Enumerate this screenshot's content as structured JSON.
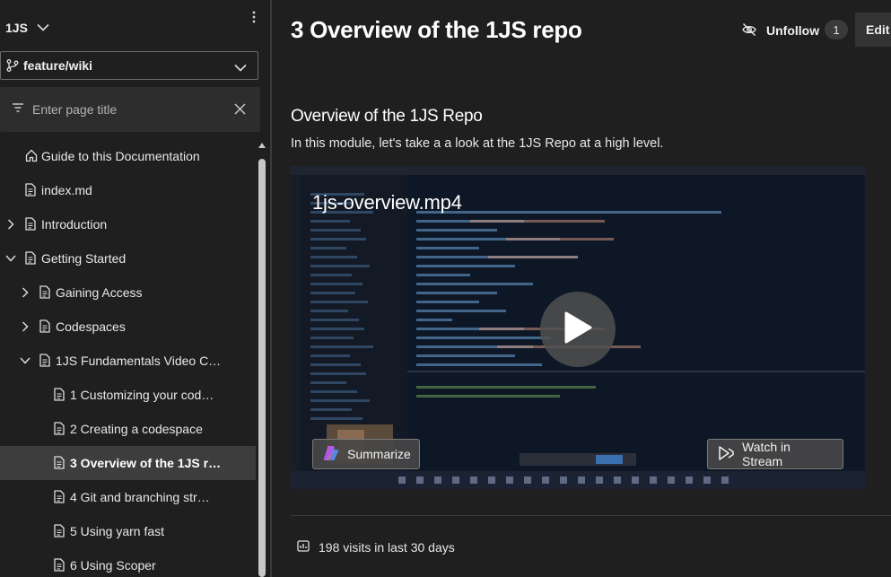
{
  "sidebar": {
    "wiki_name": "1JS",
    "branch": "feature/wiki",
    "filter_placeholder": "Enter page title",
    "tree": [
      {
        "label": "Guide to this Documentation",
        "level": 0,
        "expander": "none",
        "selected": false
      },
      {
        "label": "index.md",
        "level": 0,
        "expander": "none",
        "selected": false
      },
      {
        "label": "Introduction",
        "level": 0,
        "expander": "collapsed",
        "selected": false
      },
      {
        "label": "Getting Started",
        "level": 0,
        "expander": "expanded",
        "selected": false
      },
      {
        "label": "Gaining Access",
        "level": 1,
        "expander": "collapsed",
        "selected": false
      },
      {
        "label": "Codespaces",
        "level": 1,
        "expander": "collapsed",
        "selected": false
      },
      {
        "label": "1JS Fundamentals Video C…",
        "level": 1,
        "expander": "expanded",
        "selected": false
      },
      {
        "label": "1 Customizing your cod…",
        "level": 2,
        "expander": "none",
        "selected": false
      },
      {
        "label": "2 Creating a codespace",
        "level": 2,
        "expander": "none",
        "selected": false
      },
      {
        "label": "3 Overview of the 1JS r…",
        "level": 2,
        "expander": "none",
        "selected": true
      },
      {
        "label": "4 Git and branching str…",
        "level": 2,
        "expander": "none",
        "selected": false
      },
      {
        "label": "5 Using yarn fast",
        "level": 2,
        "expander": "none",
        "selected": false
      },
      {
        "label": "6 Using Scoper",
        "level": 2,
        "expander": "none",
        "selected": false
      }
    ]
  },
  "header": {
    "title": "3 Overview of the 1JS repo",
    "unfollow_label": "Unfollow",
    "follow_count": "1",
    "edit_label": "Edit"
  },
  "content": {
    "heading": "Overview of the 1JS Repo",
    "intro": "In this module, let's take a a look at the 1JS Repo at a high level.",
    "video": {
      "filename": "1js-overview.mp4",
      "summarize_label": "Summarize",
      "watch_label": "Watch in Stream"
    }
  },
  "footer": {
    "visits": "198 visits in last 30 days"
  },
  "icons": {
    "home": "home-icon",
    "page": "page-icon",
    "branch": "git-branch-icon",
    "filter": "filter-icon",
    "clear": "close-icon",
    "unfollow": "eye-slash-icon",
    "play": "play-icon",
    "copilot": "copilot-icon",
    "stream": "stream-icon",
    "visits": "chart-icon"
  },
  "colors": {
    "background": "#1f1f1f",
    "selected_row": "#3d3d3d",
    "filter_bg": "#2d2d2d"
  }
}
